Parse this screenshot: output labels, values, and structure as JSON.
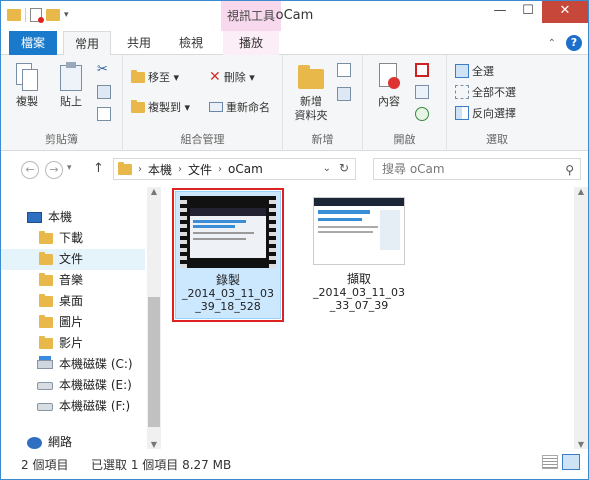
{
  "window": {
    "title": "oCam",
    "context_tab": "視訊工具"
  },
  "tabs": {
    "file": "檔案",
    "home": "常用",
    "share": "共用",
    "view": "檢視",
    "play": "播放"
  },
  "ribbon": {
    "clipboard": {
      "label": "剪貼簿",
      "copy": "複製",
      "paste": "貼上"
    },
    "organize": {
      "label": "組合管理",
      "move_to": "移至 ▾",
      "copy_to": "複製到 ▾",
      "delete": "刪除 ▾",
      "rename": "重新命名"
    },
    "new": {
      "label": "新增",
      "new_folder_line1": "新增",
      "new_folder_line2": "資料夾"
    },
    "open": {
      "label": "開啟",
      "properties": "內容"
    },
    "select": {
      "label": "選取",
      "select_all": "全選",
      "select_none": "全部不選",
      "invert": "反向選擇"
    }
  },
  "address": {
    "segments": [
      "本機",
      "文件",
      "oCam"
    ],
    "search_placeholder": "搜尋 oCam"
  },
  "nav": {
    "items": [
      {
        "label": "本機",
        "icon": "computer-icon"
      },
      {
        "label": "下載",
        "icon": "download-folder-icon"
      },
      {
        "label": "文件",
        "icon": "documents-folder-icon"
      },
      {
        "label": "音樂",
        "icon": "music-folder-icon"
      },
      {
        "label": "桌面",
        "icon": "desktop-folder-icon"
      },
      {
        "label": "圖片",
        "icon": "pictures-folder-icon"
      },
      {
        "label": "影片",
        "icon": "videos-folder-icon"
      },
      {
        "label": "本機磁碟 (C:)",
        "icon": "drive-c-icon"
      },
      {
        "label": "本機磁碟 (E:)",
        "icon": "drive-icon"
      },
      {
        "label": "本機磁碟 (F:)",
        "icon": "drive-icon"
      },
      {
        "label": "網路",
        "icon": "network-icon"
      }
    ]
  },
  "files": [
    {
      "line1": "錄製",
      "line2": "_2014_03_11_03",
      "line3": "_39_18_528",
      "type": "video",
      "selected": true
    },
    {
      "line1": "擷取",
      "line2": "_2014_03_11_03",
      "line3": "_33_07_39",
      "type": "image",
      "selected": false
    }
  ],
  "status": {
    "item_count": "2 個項目",
    "selection": "已選取 1 個項目 8.27 MB"
  },
  "colors": {
    "accent": "#1979ca",
    "selection": "#cce8ff",
    "highlight_outline": "#dd2222",
    "context_tab": "#f8d8ec"
  }
}
